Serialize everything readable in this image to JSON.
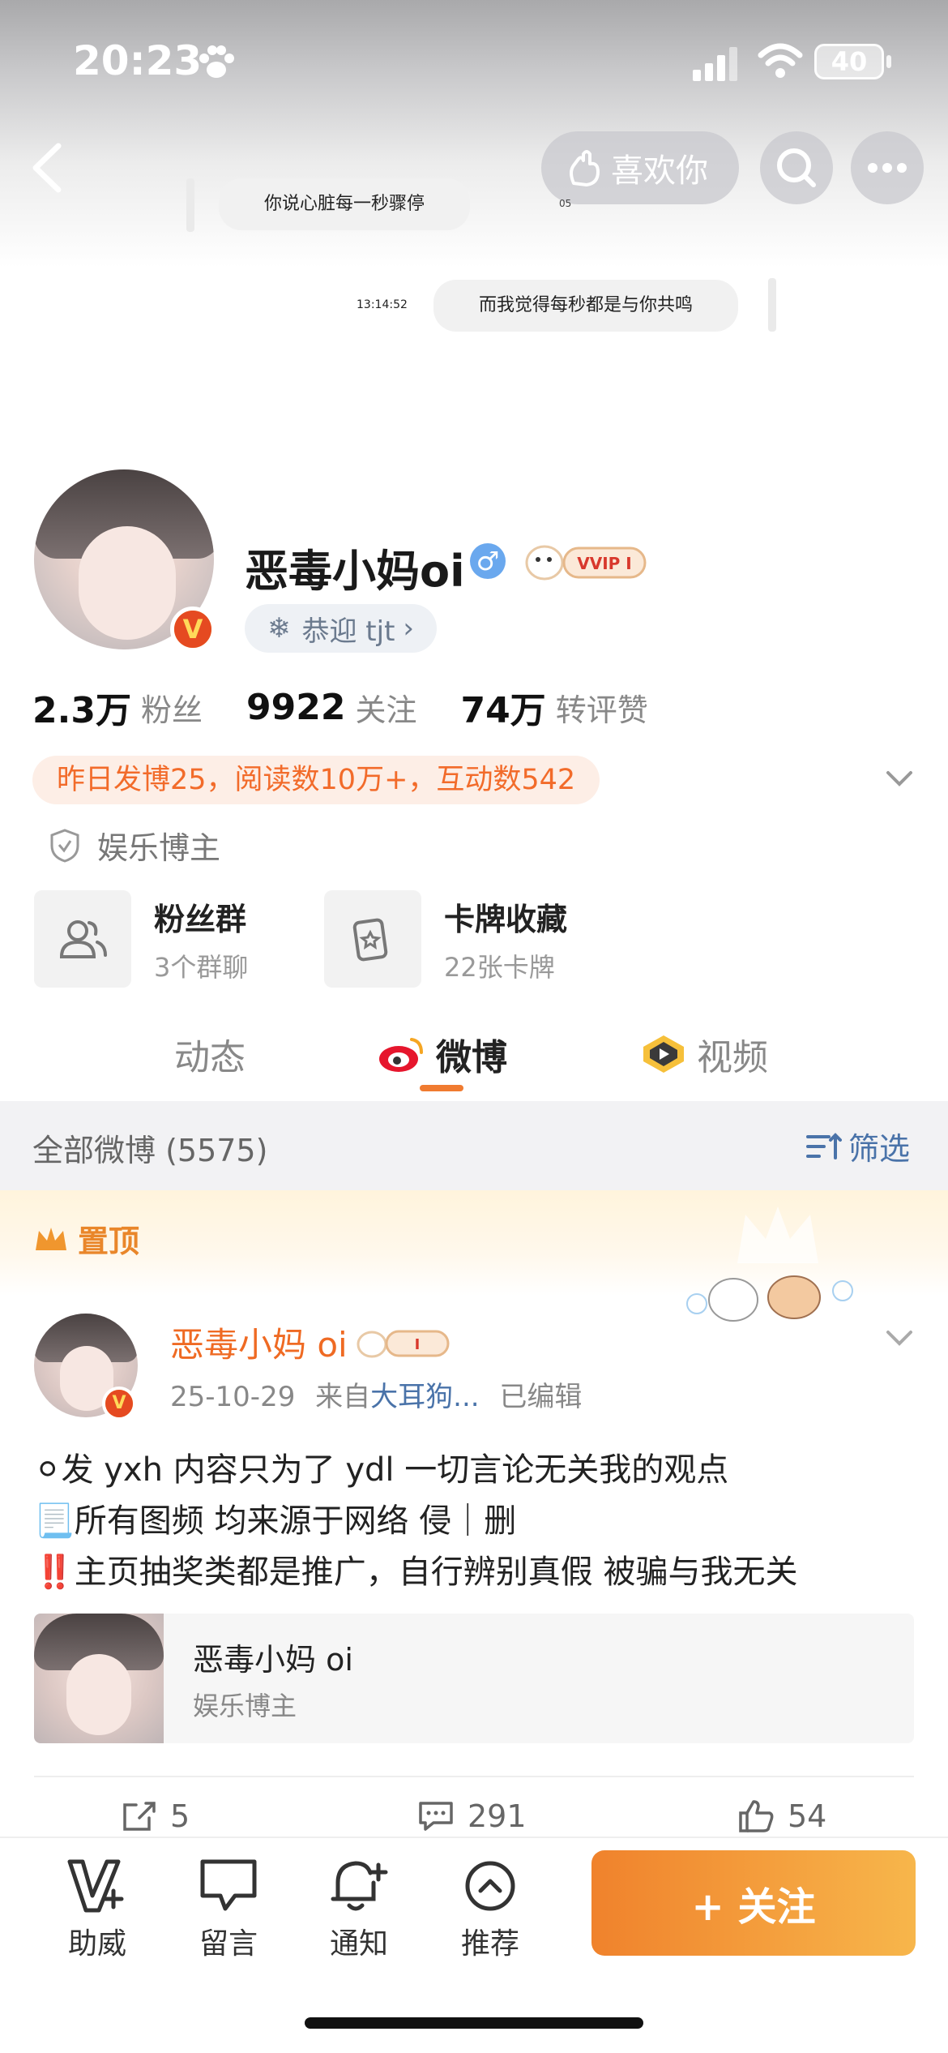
{
  "status_bar": {
    "time": "20:23",
    "battery": "40"
  },
  "header": {
    "like_label": "喜欢你"
  },
  "cover": {
    "bubble1": "你说心脏每一秒骤停",
    "bubble2": "而我觉得每秒都是与你共鸣",
    "bubble2_time": "13:14:52",
    "bubble1_time": "05"
  },
  "profile": {
    "name": "恶毒小妈oi",
    "gender_symbol": "♂",
    "fan_tag": "恭迎 tjt",
    "stats": [
      {
        "num": "2.3万",
        "label": "粉丝"
      },
      {
        "num": "9922",
        "label": "关注"
      },
      {
        "num": "74万",
        "label": "转评赞"
      }
    ],
    "activity": "昨日发博25，阅读数10万+，互动数542",
    "role": "娱乐博主",
    "cards": [
      {
        "title": "粉丝群",
        "sub": "3个群聊"
      },
      {
        "title": "卡牌收藏",
        "sub": "22张卡牌"
      }
    ]
  },
  "tabs": {
    "dynamic": "动态",
    "weibo": "微博",
    "video": "视频"
  },
  "filter_bar": {
    "all": "全部微博 (5575)",
    "filter": "筛选"
  },
  "pinned": {
    "label": "置顶"
  },
  "post": {
    "name": "恶毒小妈 oi",
    "date": "25-10-29",
    "from_prefix": "来自",
    "source": "大耳狗...",
    "edited": "已编辑",
    "lines": [
      "⚪发 yxh 内容只为了 ydl 一切言论无关我的观点",
      "📃所有图频 均来源于网络 侵｜删",
      "‼️主页抽奖类都是推广，自行辨别真假 被骗与我无关"
    ],
    "card_title": "恶毒小妈 oi",
    "card_sub": "娱乐博主",
    "shares": "5",
    "comments": "291",
    "likes": "54"
  },
  "bottom_bar": {
    "help": "助威",
    "message": "留言",
    "notify": "通知",
    "recommend": "推荐",
    "follow": "+ 关注"
  }
}
